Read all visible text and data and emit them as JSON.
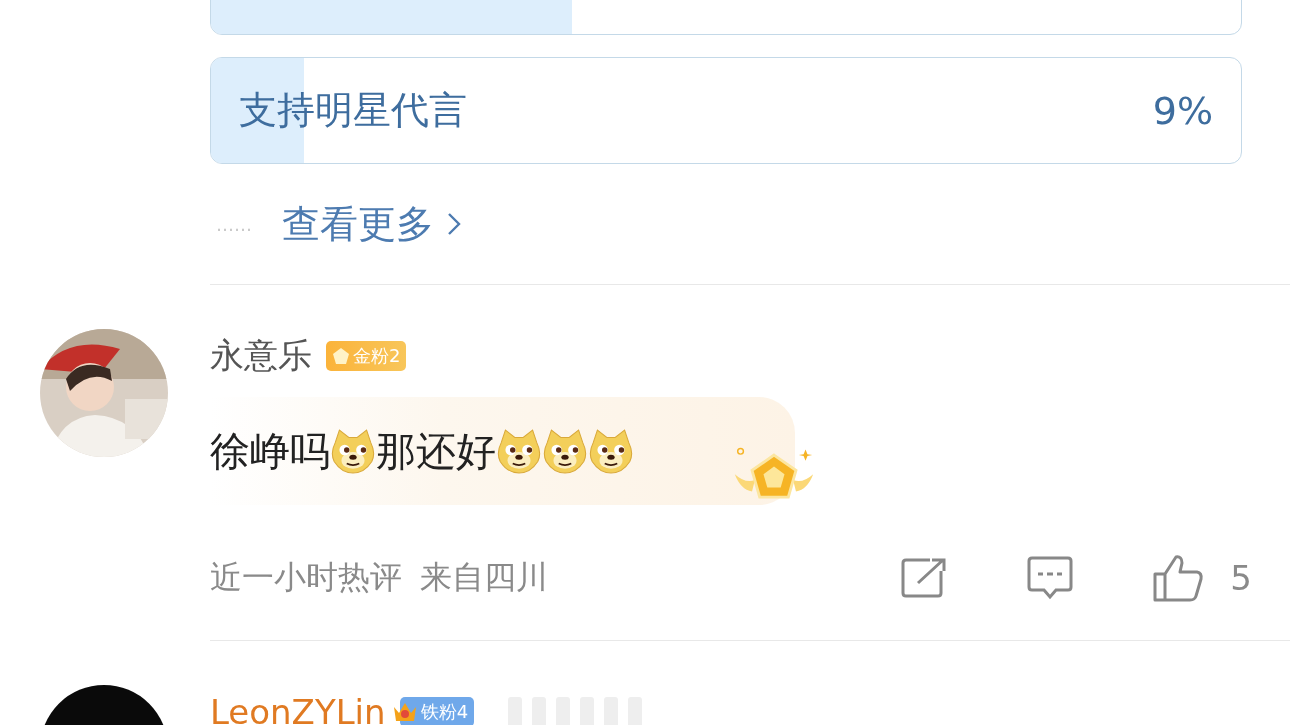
{
  "poll": {
    "options": [
      {
        "level": 0.35
      },
      {
        "label": "支持明星代言",
        "percent": "9%",
        "level": 0.09
      }
    ],
    "more": {
      "dots": "……",
      "label": "查看更多"
    }
  },
  "comments": [
    {
      "user": "永意乐",
      "vip": false,
      "badge": {
        "kind": "gold",
        "label": "金粉2"
      },
      "content": [
        {
          "kind": "text",
          "text": "徐峥吗"
        },
        {
          "kind": "emoji"
        },
        {
          "kind": "text",
          "text": "那还好"
        },
        {
          "kind": "emoji"
        },
        {
          "kind": "emoji"
        },
        {
          "kind": "emoji"
        }
      ],
      "highlight": true,
      "time": "近一小时热评",
      "location": "来自四川",
      "likes": "5"
    },
    {
      "user": "LeonZYLin",
      "vip": true,
      "badge": {
        "kind": "iron",
        "label": "铁粉4"
      },
      "avatar": {
        "kind": "dark"
      }
    }
  ]
}
